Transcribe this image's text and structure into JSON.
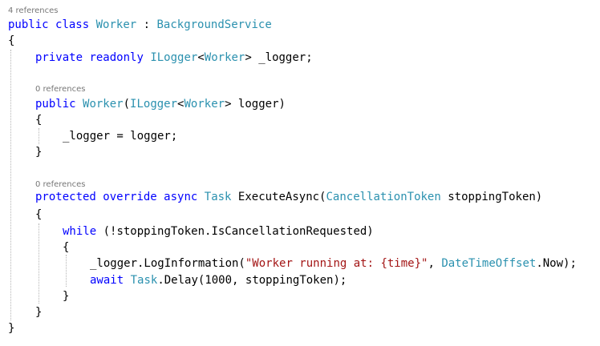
{
  "code_lens": {
    "class_refs": "4 references",
    "ctor_refs": "0 references",
    "method_refs": "0 references"
  },
  "colors": {
    "keyword": "#0000ff",
    "type": "#2b91af",
    "string": "#a31515",
    "plain": "#000000",
    "lens": "#777777"
  },
  "code": {
    "l1": {
      "kw_public": "public",
      "kw_class": "class",
      "class_name": "Worker",
      "colon": " : ",
      "base_type": "BackgroundService"
    },
    "l2": {
      "brace": "{"
    },
    "l3": {
      "kw_private": "private",
      "kw_readonly": "readonly",
      "type_ilogger": "ILogger",
      "lt": "<",
      "type_worker": "Worker",
      "rest": "> _logger;"
    },
    "l4": {
      "kw_public": "public",
      "ctor_name": "Worker",
      "paren": "(",
      "type_ilogger": "ILogger",
      "lt": "<",
      "type_worker": "Worker",
      "rest": "> logger)"
    },
    "l5": {
      "brace": "{"
    },
    "l6": {
      "text": "_logger = logger;"
    },
    "l7": {
      "brace": "}"
    },
    "l8": {
      "kw_protected": "protected",
      "kw_override": "override",
      "kw_async": "async",
      "type_task": "Task",
      "method": " ExecuteAsync(",
      "type_ct": "CancellationToken",
      "rest": " stoppingToken)"
    },
    "l9": {
      "brace": "{"
    },
    "l10": {
      "kw_while": "while",
      "rest": " (!stoppingToken.IsCancellationRequested)"
    },
    "l11": {
      "brace": "{"
    },
    "l12": {
      "pre": "_logger.LogInformation(",
      "str": "\"Worker running at: {time}\"",
      "mid": ", ",
      "type_dto": "DateTimeOffset",
      "rest": ".Now);"
    },
    "l13": {
      "kw_await": "await",
      "type_task": "Task",
      "rest": ".Delay(1000, stoppingToken);"
    },
    "l14": {
      "brace": "}"
    },
    "l15": {
      "brace": "}"
    },
    "l16": {
      "brace": "}"
    }
  }
}
